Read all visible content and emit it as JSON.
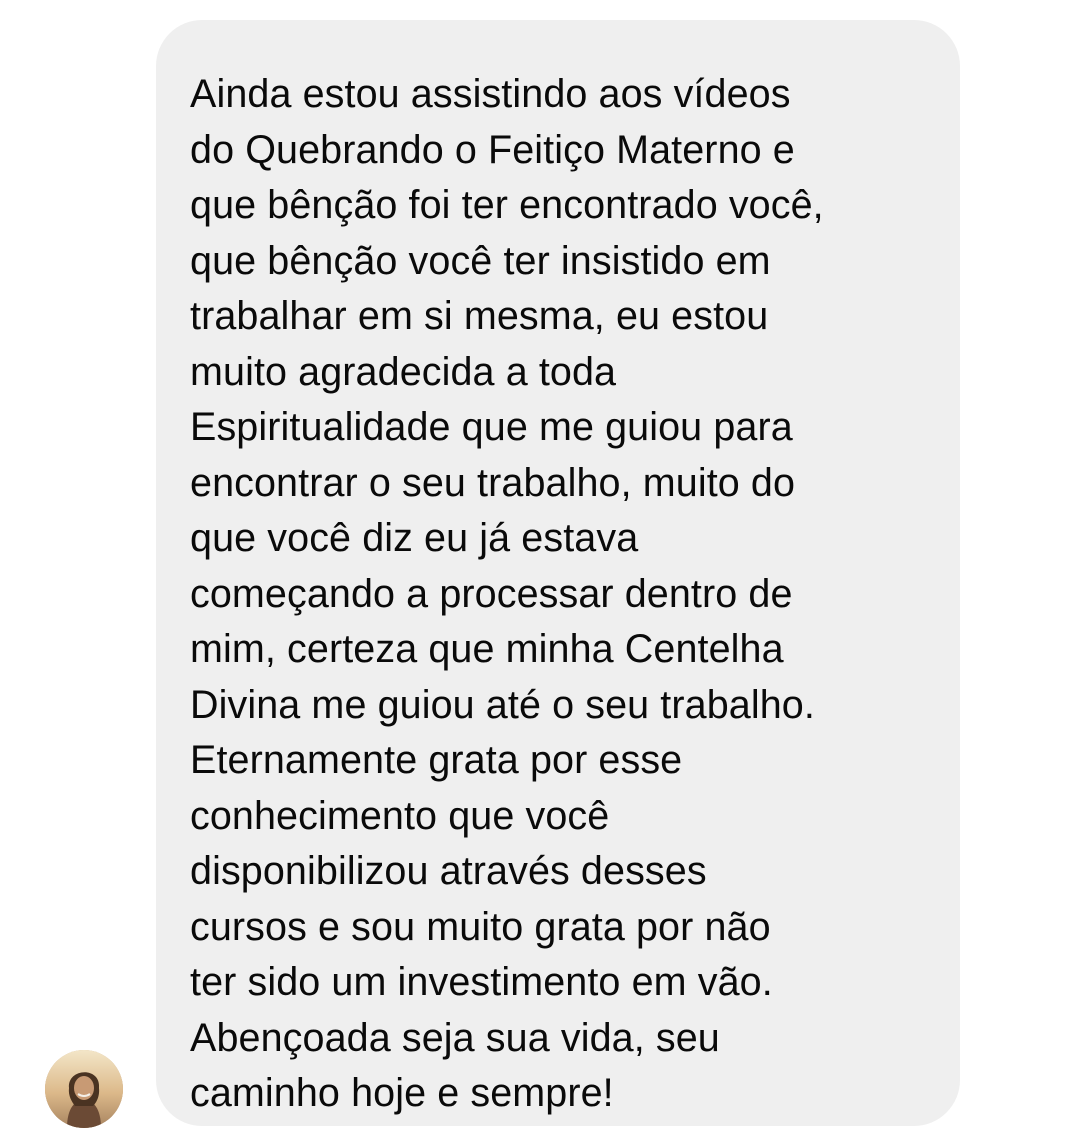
{
  "message": {
    "lines": [
      "Ainda estou assistindo aos vídeos",
      "do Quebrando o Feitiço Materno e",
      "que bênção foi ter encontrado você,",
      "que bênção você ter insistido em",
      "trabalhar em si mesma, eu estou",
      "muito agradecida a toda",
      "Espiritualidade que me guiou para",
      "encontrar o seu trabalho, muito do",
      "que você diz eu já estava",
      "começando a processar dentro de",
      "mim, certeza que minha Centelha",
      "Divina me guiou até o seu trabalho.",
      "Eternamente grata por esse",
      "conhecimento que você",
      "disponibilizou através desses",
      "cursos e sou muito grata por não",
      "ter sido um investimento em vão.",
      "Abençoada seja sua vida, seu",
      "caminho hoje e sempre!"
    ]
  },
  "colors": {
    "bubble_background": "#efefef",
    "text": "#0a0a0a",
    "page_background": "#ffffff"
  },
  "avatar": {
    "icon": "user-photo-avatar"
  }
}
